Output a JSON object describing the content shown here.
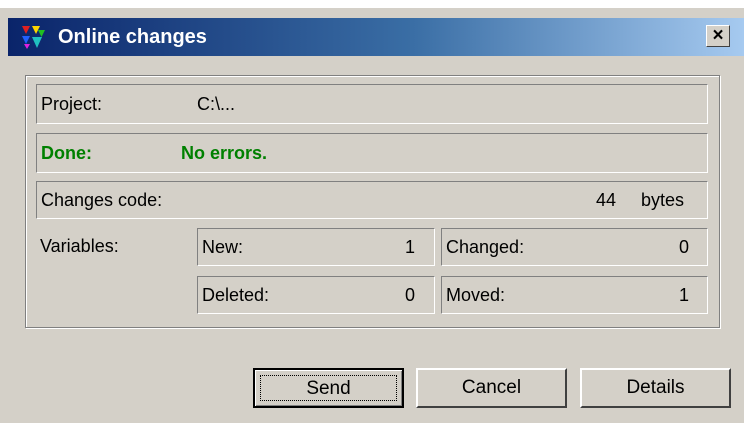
{
  "window": {
    "title": "Online changes",
    "close_glyph": "×",
    "icon": "colored-triangles-app-icon"
  },
  "project": {
    "label": "Project:",
    "value": "C:\\..."
  },
  "status": {
    "label": "Done:",
    "value": "No errors.",
    "color": "#008000"
  },
  "changes_code": {
    "label": "Changes code:",
    "value": "44",
    "unit": "bytes"
  },
  "variables": {
    "label": "Variables:",
    "new_label": "New:",
    "new_value": "1",
    "changed_label": "Changed:",
    "changed_value": "0",
    "deleted_label": "Deleted:",
    "deleted_value": "0",
    "moved_label": "Moved:",
    "moved_value": "1"
  },
  "buttons": {
    "send": "Send",
    "cancel": "Cancel",
    "details": "Details"
  },
  "colors": {
    "titlebar_start": "#0a246a",
    "titlebar_end": "#a6caf0",
    "face": "#d4d0c8"
  }
}
